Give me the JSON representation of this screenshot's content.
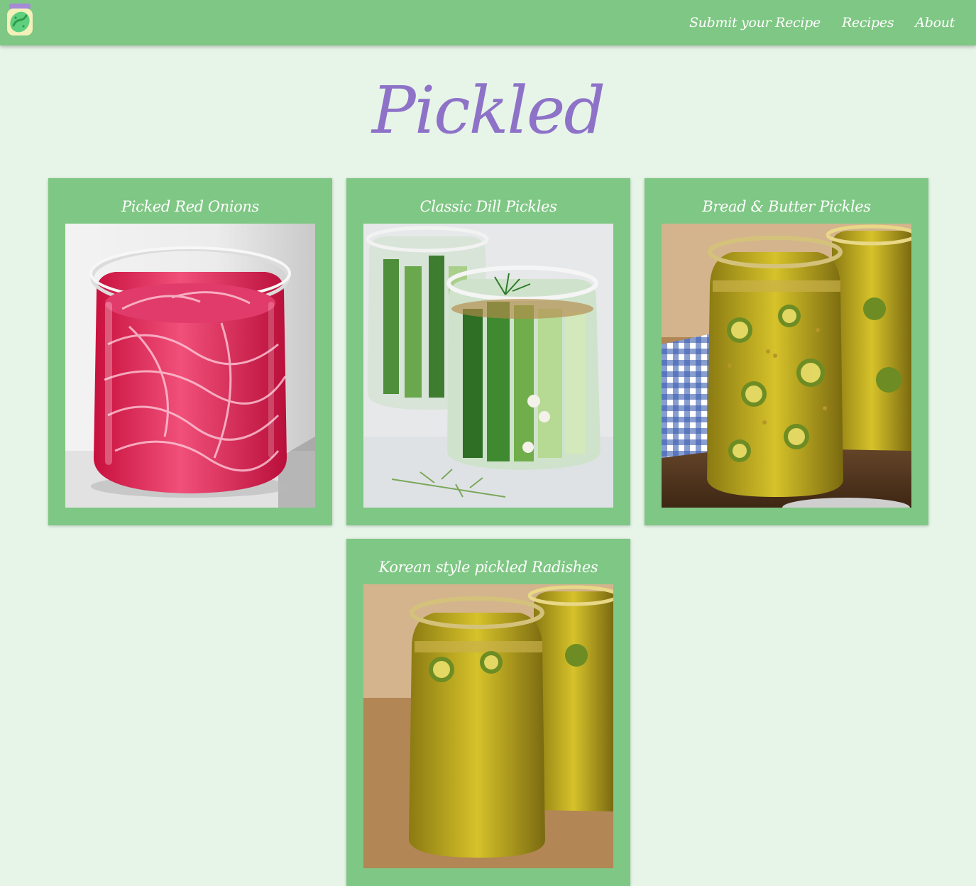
{
  "navbar": {
    "logo_icon": "pickle-jar-icon",
    "links": [
      {
        "label": "Submit your Recipe"
      },
      {
        "label": "Recipes"
      },
      {
        "label": "About"
      }
    ]
  },
  "main": {
    "title": "Pickled",
    "recipes": [
      {
        "title": "Picked Red Onions",
        "image": "pickled-red-onions-jar-photo"
      },
      {
        "title": "Classic Dill Pickles",
        "image": "dill-pickle-jars-photo"
      },
      {
        "title": "Bread & Butter Pickles",
        "image": "bread-butter-pickle-jars-photo"
      },
      {
        "title": "Korean style pickled Radishes",
        "image": "pickle-jars-photo"
      }
    ]
  },
  "colors": {
    "navbar": "#7fc784",
    "background": "#e6f5e8",
    "title": "#8e72c8",
    "card": "#7fc784"
  }
}
